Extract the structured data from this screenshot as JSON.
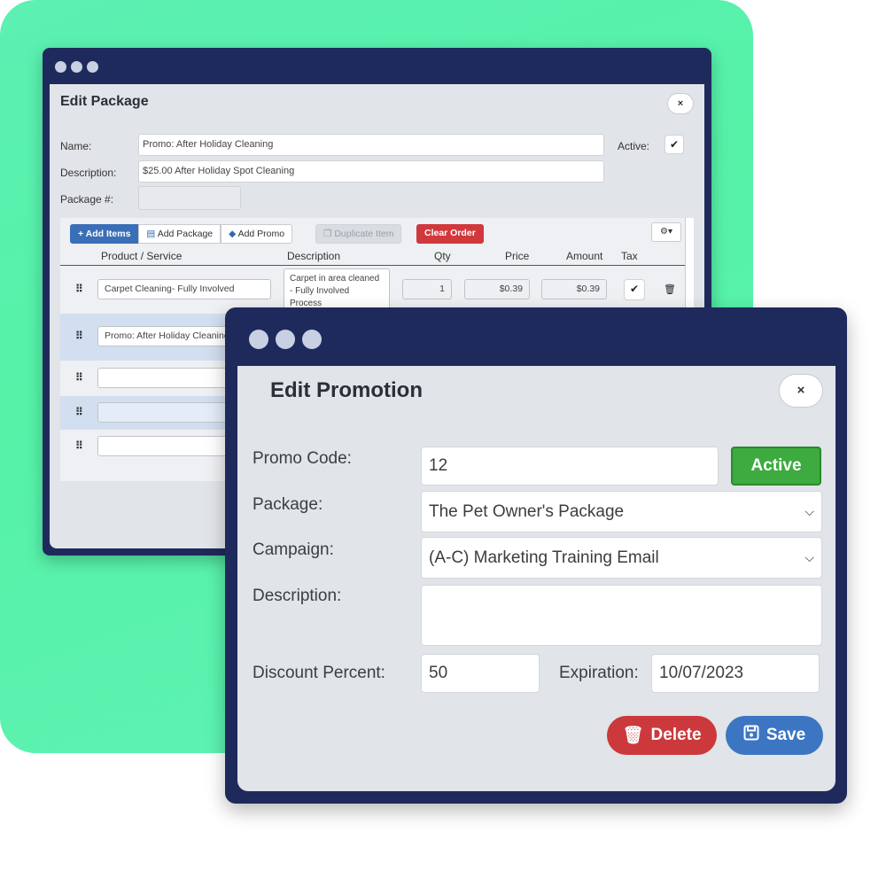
{
  "package_window": {
    "title": "Edit Package",
    "close_icon": "×",
    "name_label": "Name:",
    "name_value": "Promo:  After Holiday Cleaning",
    "description_label": "Description:",
    "description_value": "$25.00 After Holiday Spot Cleaning",
    "package_num_label": "Package #:",
    "package_num_value": "",
    "active_label": "Active:",
    "active_checked": "✔",
    "toolbar": {
      "add_items": "+ Add Items",
      "add_package": "Add Package",
      "add_promo": "Add Promo",
      "duplicate_item": "Duplicate Item",
      "clear_order": "Clear Order",
      "gear": "⚙▾"
    },
    "columns": [
      "Product / Service",
      "Description",
      "Qty",
      "Price",
      "Amount",
      "Tax"
    ],
    "rows": [
      {
        "product": "Carpet Cleaning- Fully Involved",
        "description": "Carpet in area cleaned - Fully Involved Process",
        "qty": "1",
        "price": "$0.39",
        "amount": "$0.39",
        "tax": "✔"
      },
      {
        "product": "Promo: After Holiday Cleaning"
      },
      {
        "product": ""
      },
      {
        "product": ""
      },
      {
        "product": ""
      }
    ]
  },
  "promotion_window": {
    "title": "Edit Promotion",
    "close_icon": "×",
    "promo_code_label": "Promo Code:",
    "promo_code_value": "12",
    "active_button": "Active",
    "package_label": "Package:",
    "package_value": "The Pet Owner's Package",
    "campaign_label": "Campaign:",
    "campaign_value": "(A-C) Marketing Training Email",
    "description_label": "Description:",
    "description_value": "",
    "discount_label": "Discount Percent:",
    "discount_value": "50",
    "expiration_label": "Expiration:",
    "expiration_value": "10/07/2023",
    "delete_button": "Delete",
    "save_button": "Save"
  },
  "colors": {
    "background_green": "#5cf0b2",
    "window_frame": "#1f2a5c",
    "active_green": "#3dab3f",
    "delete_red": "#cc393c",
    "save_blue": "#3c76c2"
  }
}
